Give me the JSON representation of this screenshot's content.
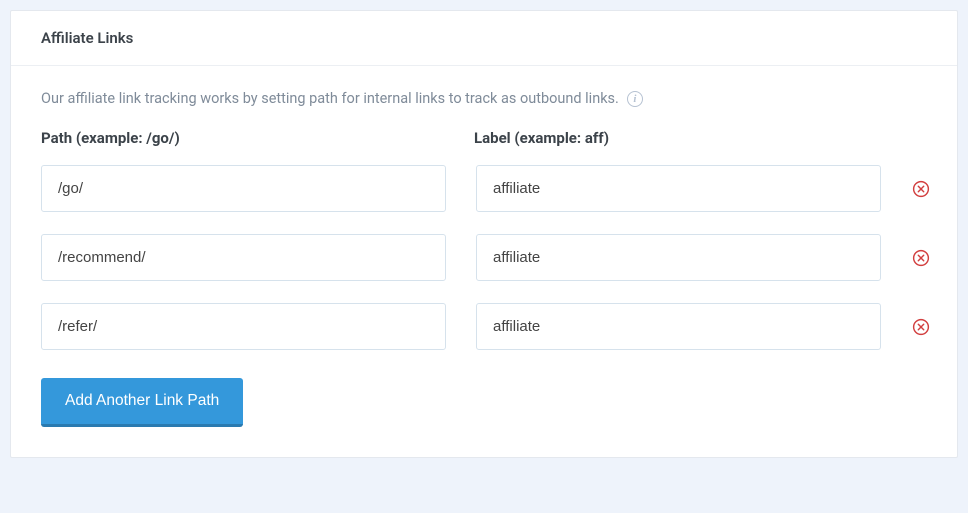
{
  "card": {
    "title": "Affiliate Links",
    "description": "Our affiliate link tracking works by setting path for internal links to track as outbound links.",
    "path_header": "Path (example: /go/)",
    "label_header": "Label (example: aff)",
    "add_button_label": "Add Another Link Path"
  },
  "rows": [
    {
      "path": "/go/",
      "label": "affiliate"
    },
    {
      "path": "/recommend/",
      "label": "affiliate"
    },
    {
      "path": "/refer/",
      "label": "affiliate"
    }
  ]
}
